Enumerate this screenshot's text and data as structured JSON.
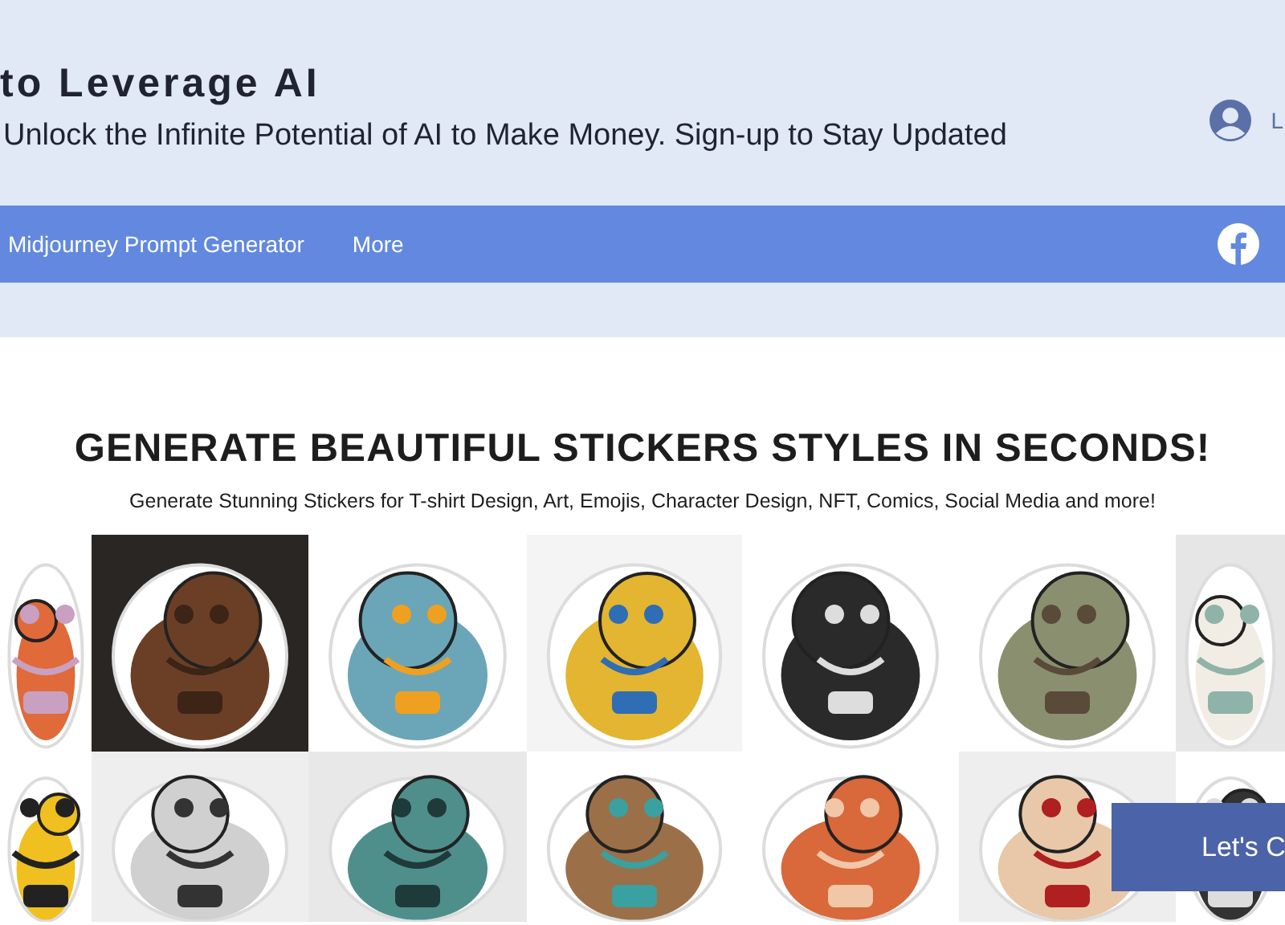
{
  "header": {
    "title": "to Leverage AI",
    "tagline": "Unlock the Infinite Potential of AI to Make Money. Sign-up to Stay Updated",
    "login_label": "L"
  },
  "nav": {
    "items": [
      {
        "label": "Midjourney Prompt Generator"
      },
      {
        "label": "More"
      }
    ]
  },
  "hero": {
    "heading": "GENERATE BEAUTIFUL STICKERS STYLES IN SECONDS!",
    "subheading": "Generate Stunning Stickers for T-shirt Design, Art, Emojis, Character Design, NFT, Comics, Social Media and more!"
  },
  "cta": {
    "label": "Let's C"
  }
}
